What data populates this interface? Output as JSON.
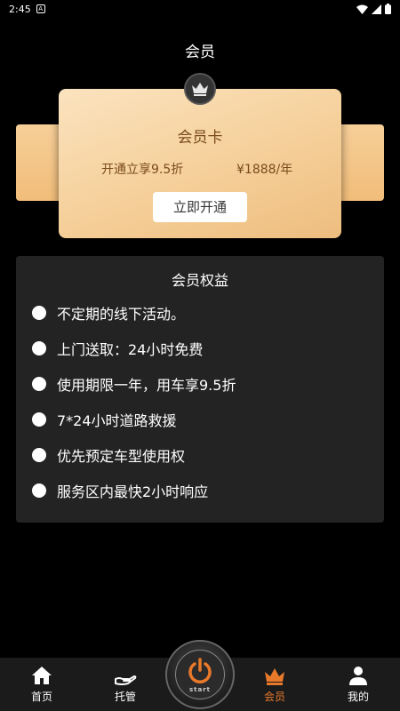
{
  "status_bar": {
    "time": "2:45",
    "notif_letter": "A"
  },
  "page": {
    "title": "会员"
  },
  "card": {
    "title": "会员卡",
    "offer": "开通立享9.5折",
    "price": "¥1888/年",
    "button": "立即开通"
  },
  "benefits": {
    "title": "会员权益",
    "items": [
      "不定期的线下活动。",
      "上门送取：24小时免费",
      "使用期限一年，用车享9.5折",
      "7*24小时道路救援",
      "优先预定车型使用权",
      "服务区内最快2小时响应"
    ]
  },
  "tabs": [
    {
      "label": "首页",
      "icon": "home-icon"
    },
    {
      "label": "托管",
      "icon": "hand-icon"
    },
    {
      "label": "会员",
      "icon": "crown-icon",
      "active": true
    },
    {
      "label": "我的",
      "icon": "person-icon"
    }
  ],
  "start": {
    "label": "start",
    "icon": "power-icon"
  },
  "colors": {
    "accent": "#e8792b",
    "card_gold": "#f5cf99",
    "card_text": "#7a4a1d"
  }
}
